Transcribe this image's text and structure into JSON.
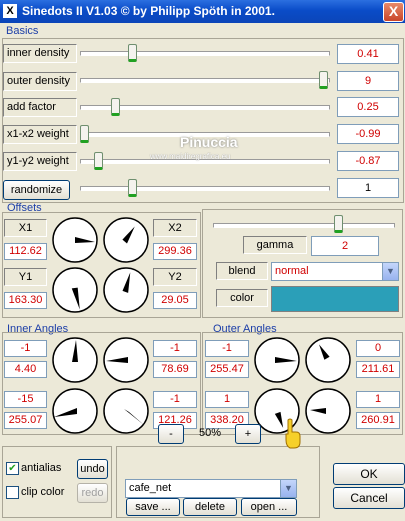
{
  "window": {
    "title": "Sinedots II V1.03 © by Philipp Spöth in 2001.",
    "close": "X",
    "app_icon": "X"
  },
  "basics": {
    "title": "Basics",
    "rows": [
      {
        "label": "inner density",
        "value": "0.41",
        "level": 0.2
      },
      {
        "label": "outer density",
        "value": "9",
        "level": 1.0
      },
      {
        "label": "add factor",
        "value": "0.25",
        "level": 0.13
      },
      {
        "label": "x1-x2 weight",
        "value": "-0.99",
        "level": 0.0
      },
      {
        "label": "y1-y2 weight",
        "value": "-0.87",
        "level": 0.06
      },
      {
        "label": "randomize",
        "value": "1",
        "level": 0.2
      }
    ]
  },
  "watermark": {
    "name": "Pinuccia",
    "site": "www.maidiregrafica.eu"
  },
  "offsets": {
    "title": "Offsets",
    "x1": "X1",
    "x1_val": "112.62",
    "y1": "Y1",
    "y1_val": "163.30",
    "x2": "X2",
    "x2_val": "299.36",
    "y2": "Y2",
    "y2_val": "29.05"
  },
  "gamma": {
    "label": "gamma",
    "value": "2",
    "level": 0.71
  },
  "blend": {
    "label": "blend",
    "selected": "normal"
  },
  "color": {
    "label": "color",
    "swatch": "#2b9fb8"
  },
  "inner_angles": {
    "title": "Inner Angles",
    "a1": "-1",
    "a1_val": "4.40",
    "a2": "-1",
    "a2_val": "78.69",
    "a3": "-15",
    "a3_val": "255.07",
    "a4": "-1",
    "a4_val": "121.26"
  },
  "outer_angles": {
    "title": "Outer Angles",
    "a1": "-1",
    "a1_val": "255.47",
    "a2": "0",
    "a2_val": "211.61",
    "a3": "1",
    "a3_val": "338.20",
    "a4": "1",
    "a4_val": "260.91"
  },
  "options": {
    "antialias": "antialias",
    "clip_color": "clip color",
    "undo": "undo",
    "redo": "redo"
  },
  "preset": {
    "minus": "-",
    "zoom": "50%",
    "plus": "+",
    "selected": "cafe_net",
    "save": "save ...",
    "delete": "delete",
    "open": "open ..."
  },
  "footer": {
    "ok": "OK",
    "cancel": "Cancel"
  }
}
